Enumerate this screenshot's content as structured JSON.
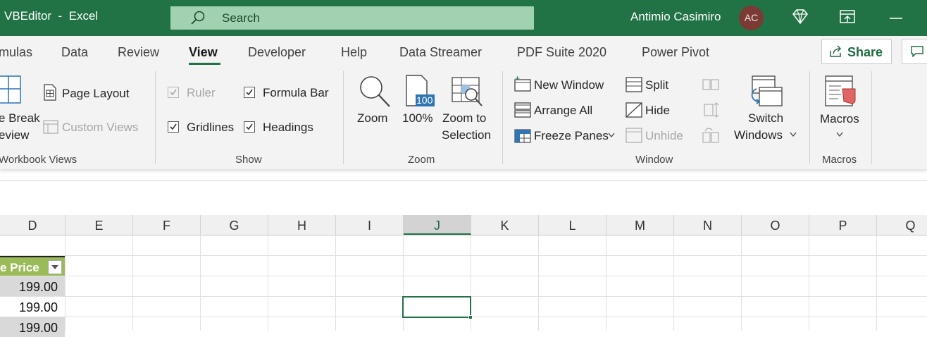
{
  "window": {
    "title": "VBEditor  -  Excel",
    "user_name": "Antimio Casimiro",
    "avatar_initials": "AC"
  },
  "search": {
    "placeholder": "Search"
  },
  "tabs": [
    {
      "label": "mulas",
      "active": false
    },
    {
      "label": "Data",
      "active": false
    },
    {
      "label": "Review",
      "active": false
    },
    {
      "label": "View",
      "active": true
    },
    {
      "label": "Developer",
      "active": false
    },
    {
      "label": "Help",
      "active": false
    },
    {
      "label": "Data Streamer",
      "active": false
    },
    {
      "label": "PDF Suite 2020",
      "active": false
    },
    {
      "label": "Power Pivot",
      "active": false
    }
  ],
  "share": {
    "label": "Share"
  },
  "ribbon": {
    "workbook_views": {
      "group_label": "Workbook Views",
      "page_break_line1": "e Break",
      "page_break_line2": "eview",
      "page_layout": "Page Layout",
      "custom_views": "Custom Views"
    },
    "show": {
      "group_label": "Show",
      "ruler": {
        "label": "Ruler",
        "checked": true,
        "enabled": false
      },
      "formula_bar": {
        "label": "Formula Bar",
        "checked": true
      },
      "gridlines": {
        "label": "Gridlines",
        "checked": true
      },
      "headings": {
        "label": "Headings",
        "checked": true
      }
    },
    "zoom": {
      "group_label": "Zoom",
      "zoom": "Zoom",
      "hundred": "100%",
      "hundred_icon_text": "100",
      "zoom_to_selection_line1": "Zoom to",
      "zoom_to_selection_line2": "Selection"
    },
    "window": {
      "group_label": "Window",
      "new_window": "New Window",
      "arrange_all": "Arrange All",
      "freeze_panes": "Freeze Panes",
      "split": "Split",
      "hide": "Hide",
      "unhide": "Unhide",
      "switch_line1": "Switch",
      "switch_line2": "Windows"
    },
    "macros": {
      "group_label": "Macros",
      "macros": "Macros"
    }
  },
  "grid": {
    "columns": [
      "D",
      "E",
      "F",
      "G",
      "H",
      "I",
      "J",
      "K",
      "L",
      "M",
      "N",
      "O",
      "P",
      "Q"
    ],
    "selected_column": "J",
    "header_cell": "e Price",
    "values": [
      "199.00",
      "199.00",
      "199.00"
    ]
  },
  "colors": {
    "excel_green": "#217346",
    "search_bg": "#a0d1b0",
    "table_header": "#9bbb59",
    "avatar": "#7b3a33"
  }
}
